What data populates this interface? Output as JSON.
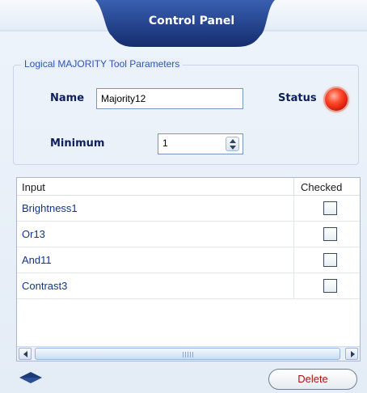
{
  "header": {
    "title": "Control Panel"
  },
  "parameters": {
    "group_title": "Logical MAJORITY Tool Parameters",
    "name_label": "Name",
    "name_value": "Majority12",
    "status_label": "Status",
    "status_color": "#ff3b1f",
    "minimum_label": "Minimum",
    "minimum_value": "1"
  },
  "inputs_table": {
    "columns": [
      "Input",
      "Checked"
    ],
    "rows": [
      {
        "input": "Brightness1",
        "checked": false
      },
      {
        "input": "Or13",
        "checked": false
      },
      {
        "input": "And11",
        "checked": false
      },
      {
        "input": "Contrast3",
        "checked": false
      }
    ]
  },
  "footer": {
    "delete_label": "Delete"
  },
  "colors": {
    "accent": "#1c3a78",
    "label_blue": "#2d55b4",
    "delete_text": "#b01212"
  }
}
